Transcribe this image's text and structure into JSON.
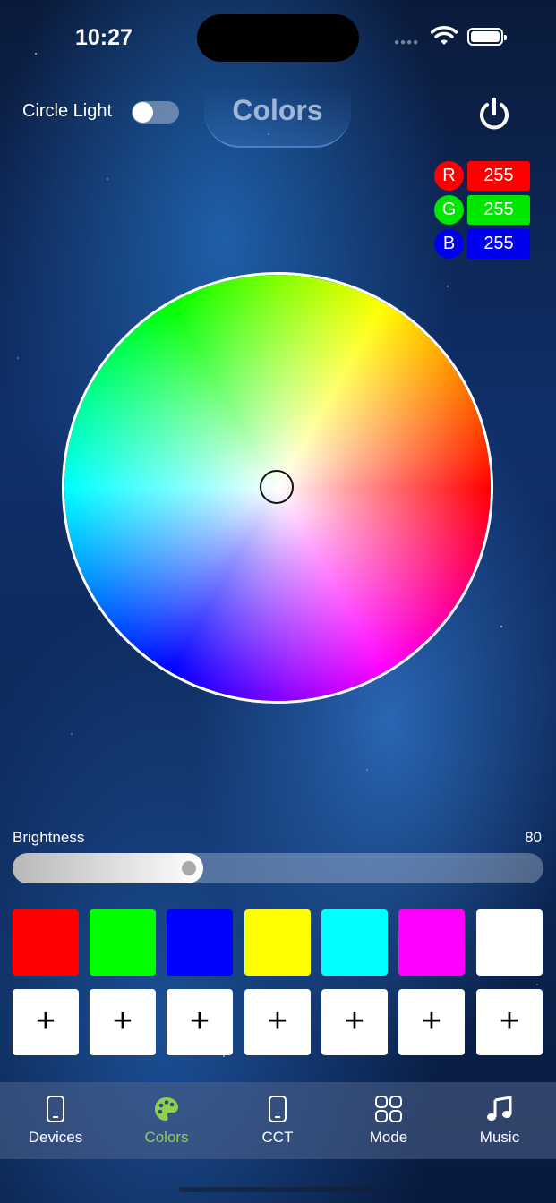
{
  "status": {
    "time": "10:27"
  },
  "header": {
    "circle_label": "Circle Light",
    "toggle_on": false,
    "title": "Colors"
  },
  "rgb": [
    {
      "letter": "R",
      "value": "255",
      "color": "#ff0000"
    },
    {
      "letter": "G",
      "value": "255",
      "color": "#00ff00"
    },
    {
      "letter": "B",
      "value": "255",
      "color": "#0000ff"
    }
  ],
  "brightness": {
    "label": "Brightness",
    "value": "80",
    "fraction": 0.36
  },
  "swatches": [
    "#ff0000",
    "#00ff00",
    "#0000ff",
    "#ffff00",
    "#00ffff",
    "#ff00ff",
    "#ffffff"
  ],
  "add_symbol": "+",
  "tabs": [
    {
      "label": "Devices",
      "icon": "phone-icon",
      "active": false
    },
    {
      "label": "Colors",
      "icon": "palette-icon",
      "active": true
    },
    {
      "label": "CCT",
      "icon": "phone-icon",
      "active": false
    },
    {
      "label": "Mode",
      "icon": "grid-icon",
      "active": false
    },
    {
      "label": "Music",
      "icon": "music-note-icon",
      "active": false
    }
  ],
  "colors": {
    "active_tab": "#8fd14f"
  }
}
